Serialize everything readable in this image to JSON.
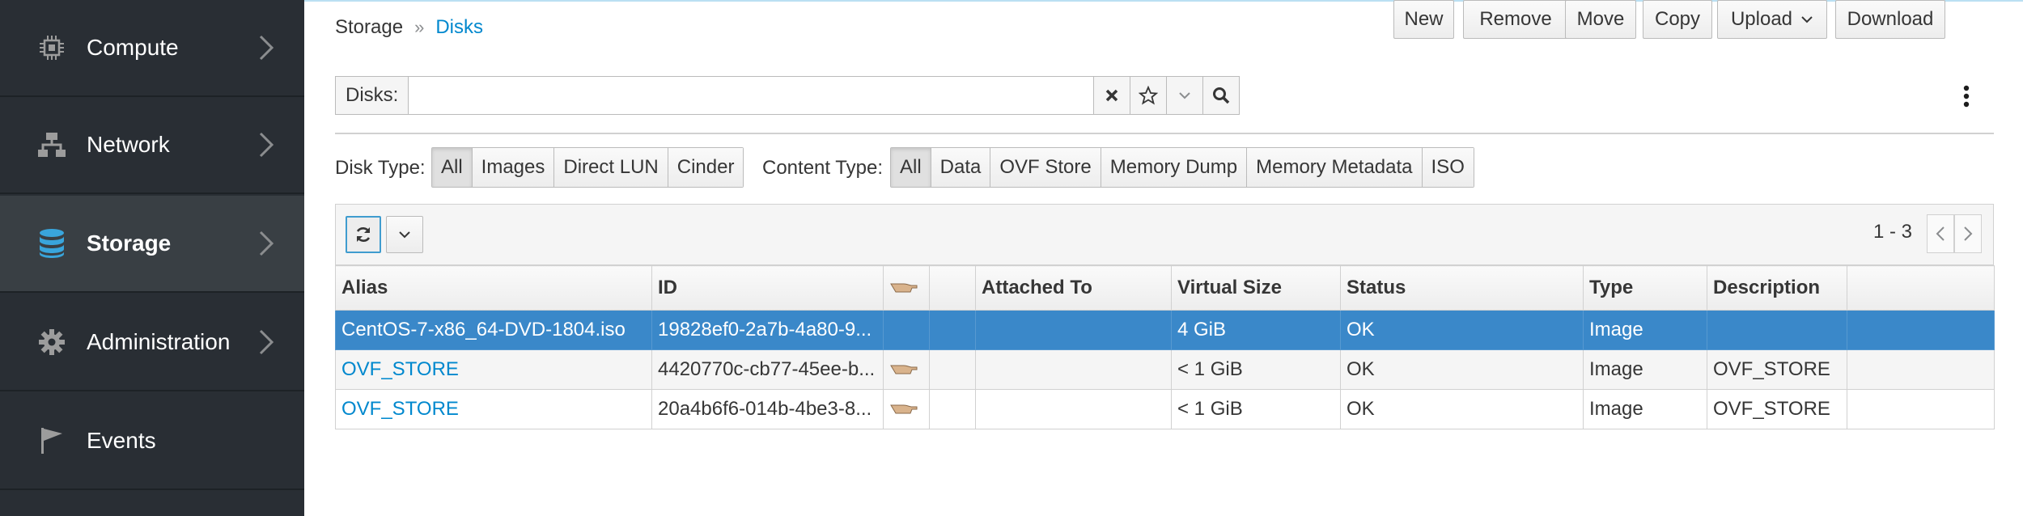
{
  "sidebar": {
    "items": [
      {
        "label": "Compute",
        "icon": "cpu-icon",
        "active": false
      },
      {
        "label": "Network",
        "icon": "network-icon",
        "active": false
      },
      {
        "label": "Storage",
        "icon": "database-icon",
        "active": true
      },
      {
        "label": "Administration",
        "icon": "gear-icon",
        "active": false
      },
      {
        "label": "Events",
        "icon": "flag-icon",
        "active": false
      }
    ]
  },
  "breadcrumb": {
    "parent": "Storage",
    "separator": "»",
    "current": "Disks"
  },
  "search": {
    "label": "Disks:",
    "value": "",
    "placeholder": ""
  },
  "toolbar": {
    "new_label": "New",
    "remove_label": "Remove",
    "move_label": "Move",
    "copy_label": "Copy",
    "upload_label": "Upload",
    "download_label": "Download"
  },
  "filters": {
    "disk_type_label": "Disk Type:",
    "disk_types": [
      "All",
      "Images",
      "Direct LUN",
      "Cinder"
    ],
    "disk_type_selected": "All",
    "content_type_label": "Content Type:",
    "content_types": [
      "All",
      "Data",
      "OVF Store",
      "Memory Dump",
      "Memory Metadata",
      "ISO"
    ],
    "content_type_selected": "All"
  },
  "pagination": {
    "range": "1 - 3"
  },
  "table": {
    "columns": [
      "Alias",
      "ID",
      "",
      "",
      "Attached To",
      "Virtual Size",
      "Status",
      "Type",
      "Description",
      ""
    ],
    "rows": [
      {
        "alias": "CentOS-7-x86_64-DVD-1804.iso",
        "id": "19828ef0-2a7b-4a80-9...",
        "attached_to": "",
        "virtual_size": "4 GiB",
        "status": "OK",
        "type": "Image",
        "description": "",
        "selected": true
      },
      {
        "alias": "OVF_STORE",
        "id": "4420770c-cb77-45ee-b...",
        "attached_to": "",
        "virtual_size": "< 1 GiB",
        "status": "OK",
        "type": "Image",
        "description": "OVF_STORE",
        "selected": false
      },
      {
        "alias": "OVF_STORE",
        "id": "20a4b6f6-014b-4be3-8...",
        "attached_to": "",
        "virtual_size": "< 1 GiB",
        "status": "OK",
        "type": "Image",
        "description": "OVF_STORE",
        "selected": false
      }
    ]
  },
  "colors": {
    "sidebar_bg": "#292e34",
    "accent": "#0088ce",
    "selected_row": "#3a88c9"
  }
}
